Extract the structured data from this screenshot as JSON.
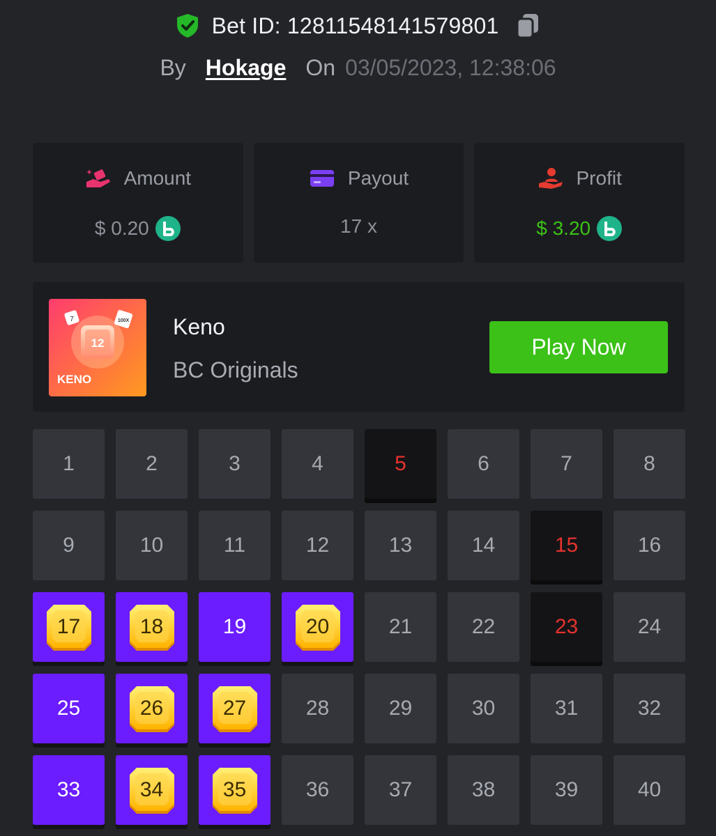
{
  "header": {
    "bet_id": "Bet ID: 12811548141579801",
    "by_label": "By",
    "username": "Hokage",
    "on_label": "On",
    "date": "03/05/2023, 12:38:06"
  },
  "stats": {
    "amount": {
      "label": "Amount",
      "value": "$ 0.20",
      "icon": "coins-hand-icon"
    },
    "payout": {
      "label": "Payout",
      "value": "17 x",
      "icon": "card-icon"
    },
    "profit": {
      "label": "Profit",
      "value": "$ 3.20",
      "icon": "hand-person-icon"
    }
  },
  "game": {
    "name": "Keno",
    "provider": "BC Originals",
    "thumb_number": "12",
    "thumb_label": "KENO",
    "thumb_dice_left": "7",
    "thumb_dice_right": "100X",
    "play_label": "Play Now"
  },
  "colors": {
    "background": "#232428",
    "card": "#1b1c20",
    "tile": "#33353b",
    "picked": "#6b1dff",
    "drawn": "#141416",
    "drawn_text": "#e5322d",
    "accent_green": "#3bc117",
    "coin": "#1fb38a"
  },
  "grid": {
    "tiles": [
      {
        "n": "1",
        "state": "normal"
      },
      {
        "n": "2",
        "state": "normal"
      },
      {
        "n": "3",
        "state": "normal"
      },
      {
        "n": "4",
        "state": "normal"
      },
      {
        "n": "5",
        "state": "drawn"
      },
      {
        "n": "6",
        "state": "normal"
      },
      {
        "n": "7",
        "state": "normal"
      },
      {
        "n": "8",
        "state": "normal"
      },
      {
        "n": "9",
        "state": "normal"
      },
      {
        "n": "10",
        "state": "normal"
      },
      {
        "n": "11",
        "state": "normal"
      },
      {
        "n": "12",
        "state": "normal"
      },
      {
        "n": "13",
        "state": "normal"
      },
      {
        "n": "14",
        "state": "normal"
      },
      {
        "n": "15",
        "state": "drawn"
      },
      {
        "n": "16",
        "state": "normal"
      },
      {
        "n": "17",
        "state": "hit"
      },
      {
        "n": "18",
        "state": "hit"
      },
      {
        "n": "19",
        "state": "picked"
      },
      {
        "n": "20",
        "state": "hit"
      },
      {
        "n": "21",
        "state": "normal"
      },
      {
        "n": "22",
        "state": "normal"
      },
      {
        "n": "23",
        "state": "drawn"
      },
      {
        "n": "24",
        "state": "normal"
      },
      {
        "n": "25",
        "state": "picked"
      },
      {
        "n": "26",
        "state": "hit"
      },
      {
        "n": "27",
        "state": "hit"
      },
      {
        "n": "28",
        "state": "normal"
      },
      {
        "n": "29",
        "state": "normal"
      },
      {
        "n": "30",
        "state": "normal"
      },
      {
        "n": "31",
        "state": "normal"
      },
      {
        "n": "32",
        "state": "normal"
      },
      {
        "n": "33",
        "state": "picked"
      },
      {
        "n": "34",
        "state": "hit"
      },
      {
        "n": "35",
        "state": "hit"
      },
      {
        "n": "36",
        "state": "normal"
      },
      {
        "n": "37",
        "state": "normal"
      },
      {
        "n": "38",
        "state": "normal"
      },
      {
        "n": "39",
        "state": "normal"
      },
      {
        "n": "40",
        "state": "normal"
      }
    ]
  }
}
